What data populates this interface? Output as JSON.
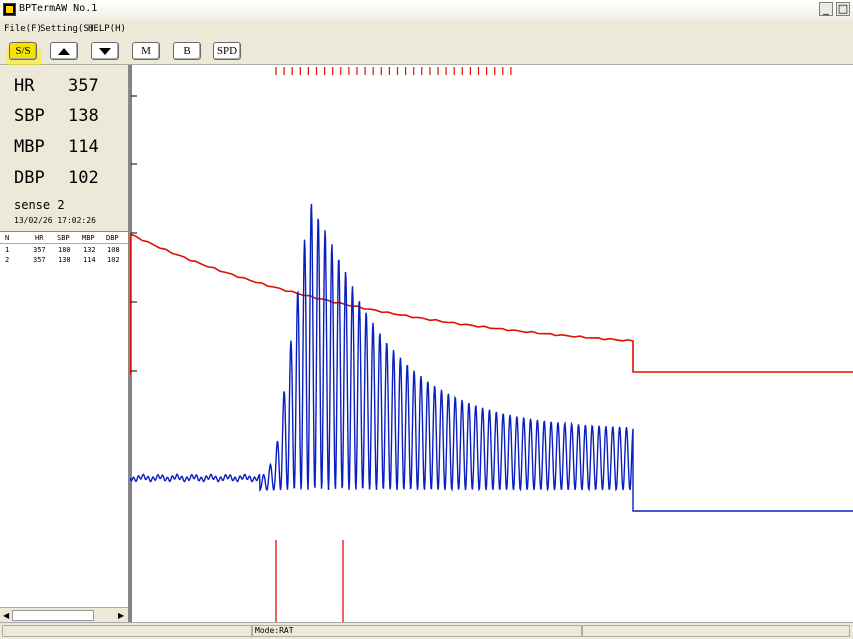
{
  "window": {
    "title": "BPTermAW No.1"
  },
  "menu": {
    "file": "File(F)",
    "setting": "Setting(S)",
    "help": "HELP(H)"
  },
  "toolbar": {
    "ss": "S/S",
    "m": "M",
    "b": "B",
    "spd": "SPD"
  },
  "readout": {
    "hr_label": "HR",
    "hr_value": "357",
    "sbp_label": "SBP",
    "sbp_value": "138",
    "mbp_label": "MBP",
    "mbp_value": "114",
    "dbp_label": "DBP",
    "dbp_value": "102",
    "sense": "sense 2",
    "timestamp": "13/02/26 17:02:26"
  },
  "table": {
    "headers": [
      "N",
      "HR",
      "SBP",
      "MBP",
      "DBP"
    ],
    "rows": [
      [
        "1",
        "357",
        "180",
        "132",
        "108"
      ],
      [
        "2",
        "357",
        "138",
        "114",
        "102"
      ]
    ]
  },
  "status": {
    "mode": "Mode:RAT"
  },
  "colors": {
    "pressure": "#dd1100",
    "pulse": "#0a1fc0",
    "plot_bg": "#ffffff"
  }
}
